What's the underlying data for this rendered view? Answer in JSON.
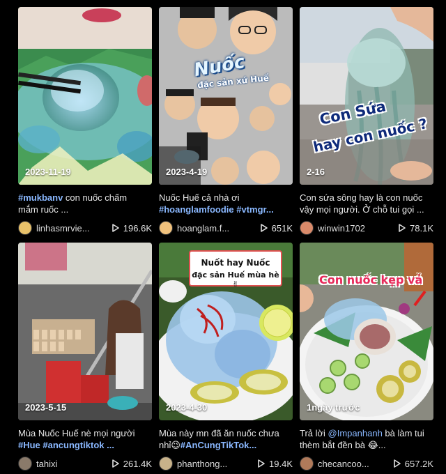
{
  "videos": [
    {
      "date": "2023-11-19",
      "caption_tag": "#mukbanv",
      "caption_text": " con nuốc chấm mắm ruốc ...",
      "username": "linhasmrvie...",
      "views": "196.6K",
      "avatar_color": "#e8c16a"
    },
    {
      "date": "2023-4-19",
      "caption_text": "Nuốc Huế cả nhà ơi ",
      "caption_tag": "#hoanglamfoodie #vtmgr...",
      "username": "hoanglam.f...",
      "views": "651K",
      "overlay_title": "Nuốc",
      "overlay_subtitle": "đặc sản xứ Huế",
      "avatar_color": "#f1c27d"
    },
    {
      "date": "2-16",
      "caption_text": "Con sứa sông hay là con nuốc vậy mọi người. Ở chỗ tui gọi ...",
      "username": "winwin1702",
      "views": "78.1K",
      "overlay_line1": "Con Sứa",
      "overlay_line2": "hay con nuốc ?",
      "avatar_color": "#d98a6a"
    },
    {
      "date": "2023-5-15",
      "caption_text": "Mùa Nuốc Huế nè mọi người ",
      "caption_tag": "#Hue #ancungtiktok ...",
      "username": "tahixi",
      "views": "261.4K",
      "avatar_color": "#8a7a6a"
    },
    {
      "date": "2023-4-30",
      "caption_text": "Mùa này mn đã ăn nuốc chưa nhỉ😉",
      "caption_tag": "#AnCungTikTok...",
      "username": "phanthong...",
      "views": "19.4K",
      "overlay_line1": "Nuốt hay Nuốc",
      "overlay_line2": "đặc sản Huế mùa hè✌",
      "avatar_color": "#c8b28a"
    },
    {
      "date": "1ngày trước",
      "caption_prefix": "Trả lời ",
      "caption_mention": "@Impanhanh",
      "caption_text": " bà làm tui thèm bắt đền bà 😂...",
      "username": "checancoo...",
      "views": "657.2K",
      "overlay_title": "Con nuốc kẹp vả",
      "avatar_color": "#b07a5a"
    }
  ],
  "colors": {
    "background": "#000000",
    "hashtag": "#8ab8ff",
    "text": "#e6e6e6"
  }
}
